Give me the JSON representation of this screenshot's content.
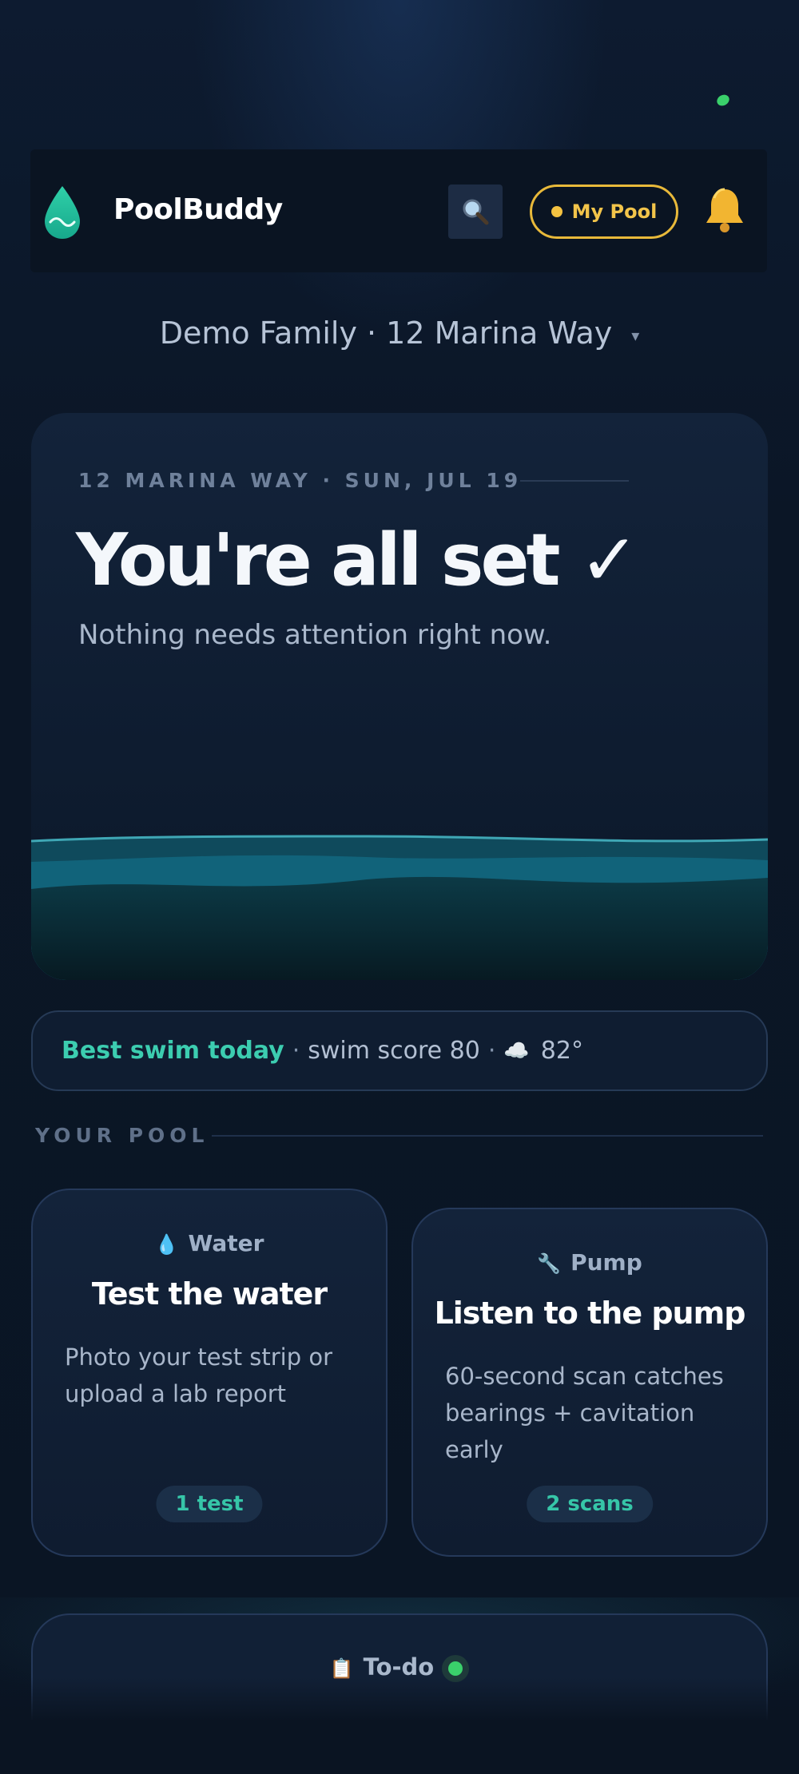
{
  "header": {
    "brand": "PoolBuddy",
    "search_icon": "search-icon",
    "my_pool_label": "My Pool",
    "bell_icon": "bell-icon"
  },
  "family_selector": {
    "label": "Demo Family · 12 Marina Way",
    "caret": "▾"
  },
  "hero": {
    "kicker": "12 MARINA WAY · SUN, JUL 19",
    "title": "You're all set ✓",
    "subtitle": "Nothing needs attention right now."
  },
  "swim": {
    "highlight": "Best swim today",
    "sep1": "·",
    "score": "swim score 80",
    "sep2": "·",
    "weather_icon": "☁️",
    "temp": "82°"
  },
  "section": {
    "label": "YOUR POOL"
  },
  "cards": [
    {
      "icon": "💧",
      "category": "Water",
      "title": "Test the water",
      "description": "Photo your test strip or upload a lab report",
      "badge": "1 test"
    },
    {
      "icon": "🔧",
      "category": "Pump",
      "title": "Listen to the pump",
      "description": "60-second scan catches bearings + cavitation early",
      "badge": "2 scans"
    }
  ],
  "todo": {
    "icon": "📋",
    "label": "To-do"
  },
  "colors": {
    "accent_teal": "#3ccdb0",
    "accent_gold": "#e8b93a",
    "status_green": "#3ad06b",
    "background": "#0b1626"
  }
}
